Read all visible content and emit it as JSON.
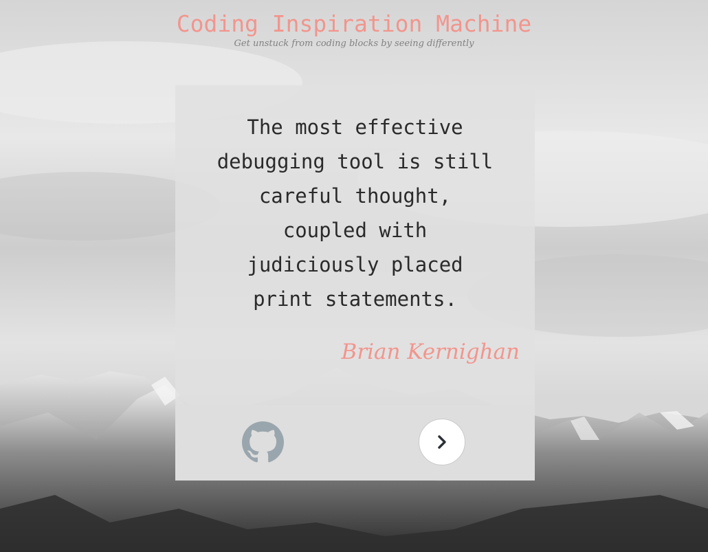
{
  "header": {
    "title": "Coding Inspiration Machine",
    "subtitle": "Get unstuck from coding blocks by seeing differently"
  },
  "quote": {
    "lines": [
      "The most effective",
      "debugging tool is still",
      "careful thought,",
      "coupled with",
      "judiciously placed",
      "print statements."
    ],
    "author": "Brian Kernighan"
  },
  "footer": {
    "github_icon": "github-icon",
    "next_icon": "chevron-right-icon"
  },
  "colors": {
    "accent": "#f2958d",
    "quote_text": "#2a2a2a",
    "subtitle": "#808080",
    "github_icon": "#9aa6ad",
    "next_icon": "#2b2f36"
  }
}
